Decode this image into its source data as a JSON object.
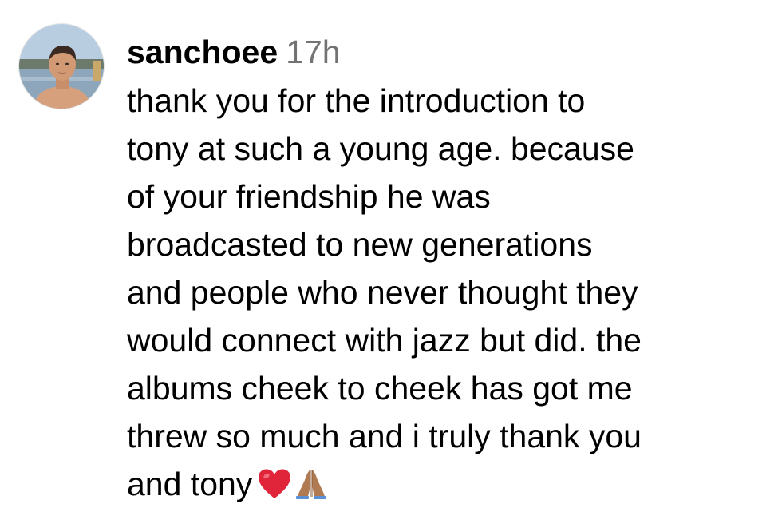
{
  "comment": {
    "username": "sanchoee",
    "timestamp": "17h",
    "lines": [
      "thank you for the introduction to",
      "tony at such a young age. because",
      "of your friendship he was",
      "broadcasted to new generations",
      "and people who never thought they",
      "would connect with jazz but did. the",
      "albums cheek to cheek has got me",
      "threw so much and i truly thank you",
      "and tony"
    ],
    "emojis": [
      "red-heart-emoji",
      "folded-hands-emoji"
    ]
  },
  "colors": {
    "text": "#000000",
    "timestamp": "#737373",
    "heart": "#E0243A",
    "hands": "#B07A52"
  }
}
